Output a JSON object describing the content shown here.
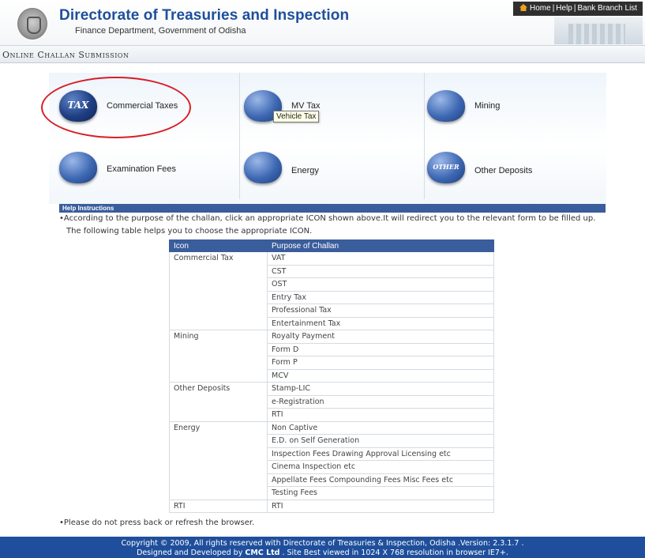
{
  "header": {
    "title": "Directorate of Treasuries and Inspection",
    "subtitle": "Finance Department, Government of Odisha",
    "links": [
      "Home",
      "Help",
      "Bank Branch List"
    ]
  },
  "section": {
    "title": "Online Challan Submission"
  },
  "icons": [
    {
      "label": "Commercial Taxes",
      "glyph": "TAX",
      "icon": "tax-icon"
    },
    {
      "label": "MV Tax",
      "glyph": "",
      "icon": "car-icon"
    },
    {
      "label": "Mining",
      "glyph": "",
      "icon": "mining-cart-icon"
    },
    {
      "label": "Examination Fees",
      "glyph": "",
      "icon": "graduation-cap-icon"
    },
    {
      "label": "Energy",
      "glyph": "",
      "icon": "energy-icon"
    },
    {
      "label": "Other Deposits",
      "glyph": "OTHER",
      "icon": "other-deposits-icon"
    }
  ],
  "tooltip": "Vehicle Tax",
  "help": {
    "heading": "Help Instructions",
    "line1": "•According to the purpose of the challan, click an appropriate ICON shown above.It will redirect you to the relevant form to be filled up.",
    "line2": "The following table helps you to choose the appropriate ICON."
  },
  "table": {
    "headers": [
      "Icon",
      "Purpose of Challan"
    ],
    "groups": [
      {
        "icon": "Commercial Tax",
        "purposes": [
          "VAT",
          "CST",
          "OST",
          "Entry Tax",
          "Professional Tax",
          "Entertainment Tax"
        ]
      },
      {
        "icon": "Mining",
        "purposes": [
          "Royalty Payment",
          "Form D",
          "Form P",
          "MCV"
        ]
      },
      {
        "icon": "Other Deposits",
        "purposes": [
          "Stamp-LIC",
          "e-Registration",
          "RTI"
        ]
      },
      {
        "icon": "Energy",
        "purposes": [
          "Non Captive",
          "E.D. on Self Generation",
          "Inspection Fees Drawing Approval Licensing etc",
          "Cinema Inspection etc",
          "Appellate Fees Compounding Fees Misc Fees etc",
          "Testing Fees"
        ]
      },
      {
        "icon": "RTI",
        "purposes": [
          "RTI"
        ]
      }
    ]
  },
  "notice": "•Please do not press back or refresh the browser.",
  "footer": {
    "line1": "Copyright © 2009, All rights reserved with Directorate of Treasuries & Inspection, Odisha .Version: 2.3.1.7 .",
    "line2_pre": "Designed and Developed by ",
    "line2_brand": "CMC Ltd",
    "line2_post": " . Site Best viewed in 1024 X 768 resolution in browser IE7+."
  },
  "colors": {
    "brand_blue": "#1e4f9c",
    "header_blue": "#3a5d9c",
    "highlight_red": "#d81e24"
  }
}
